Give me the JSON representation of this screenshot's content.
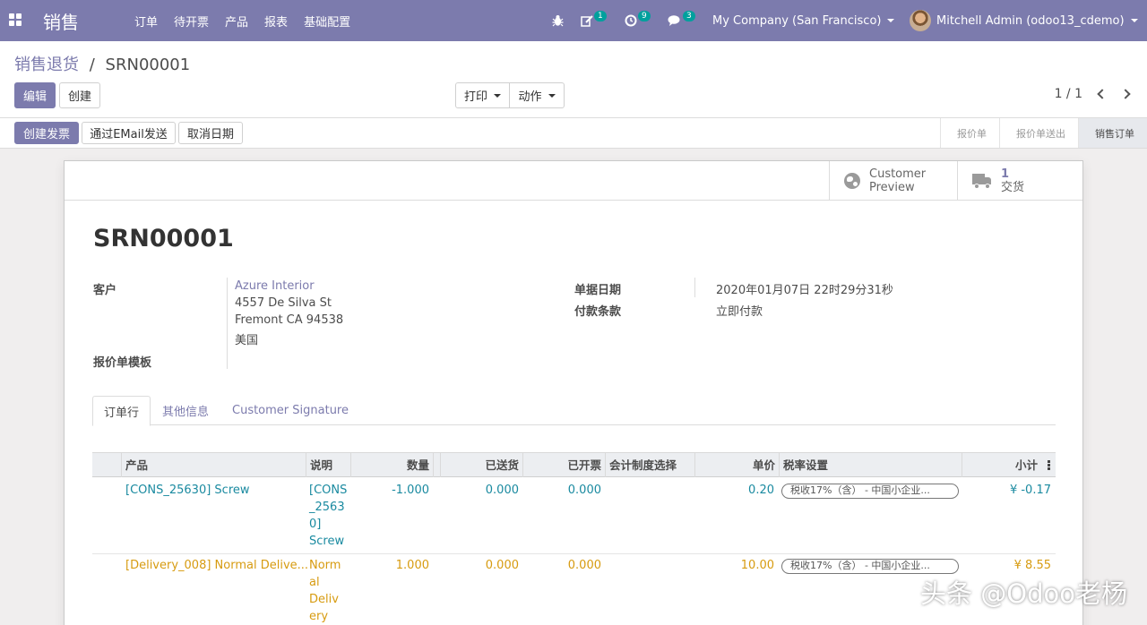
{
  "navbar": {
    "brand": "销售",
    "menu": [
      "订单",
      "待开票",
      "产品",
      "报表",
      "基础配置"
    ],
    "activity_count": "1",
    "clock_count": "9",
    "chat_count": "3",
    "company": "My Company (San Francisco)",
    "user": "Mitchell Admin (odoo13_cdemo)",
    "accent": "#7c7bad"
  },
  "breadcrumb": {
    "parent": "销售退货",
    "separator": "/",
    "current": "SRN00001"
  },
  "buttons": {
    "edit": "编辑",
    "create": "创建",
    "print": "打印",
    "action": "动作"
  },
  "pager": {
    "value": "1 / 1"
  },
  "statusbar": {
    "create_invoice": "创建发票",
    "send_email": "通过EMail发送",
    "cancel": "取消日期",
    "stages": [
      "报价单",
      "报价单送出",
      "销售订单"
    ],
    "active_stage": "销售订单"
  },
  "smart_buttons": {
    "preview_line1": "Customer",
    "preview_line2": "Preview",
    "delivery_count": "1",
    "delivery_label": "交货"
  },
  "record": {
    "name": "SRN00001",
    "customer_label": "客户",
    "customer_name": "Azure Interior",
    "address_street": "4557 De Silva St",
    "address_city": "Fremont CA 94538",
    "address_country": "美国",
    "template_label": "报价单模板",
    "date_label": "单据日期",
    "date_value": "2020年01月07日 22时29分31秒",
    "terms_label": "付款条款",
    "terms_value": "立即付款"
  },
  "tabs": [
    "订单行",
    "其他信息",
    "Customer Signature"
  ],
  "lines": {
    "headers": [
      "产品",
      "说明",
      "数量",
      "已送货",
      "已开票",
      "会计制度选择",
      "单价",
      "税率设置",
      "小计"
    ],
    "rows": [
      {
        "product": "[CONS_25630] Screw",
        "desc": [
          "[CONS",
          "_2563",
          "0]",
          "Screw"
        ],
        "qty": "-1.000",
        "delivered": "0.000",
        "invoiced": "0.000",
        "price": "0.20",
        "tax": "税收17%（含） - 中国小企业...",
        "subtotal": "¥ -0.17"
      },
      {
        "product": "[Delivery_008] Normal Delive...",
        "desc": [
          "Norm",
          "al",
          "Deliv",
          "ery"
        ],
        "qty": "1.000",
        "delivered": "0.000",
        "invoiced": "0.000",
        "price": "10.00",
        "tax": "税收17%（含） - 中国小企业...",
        "subtotal": "¥ 8.55"
      }
    ]
  },
  "watermark": "头条 @Odoo老杨"
}
